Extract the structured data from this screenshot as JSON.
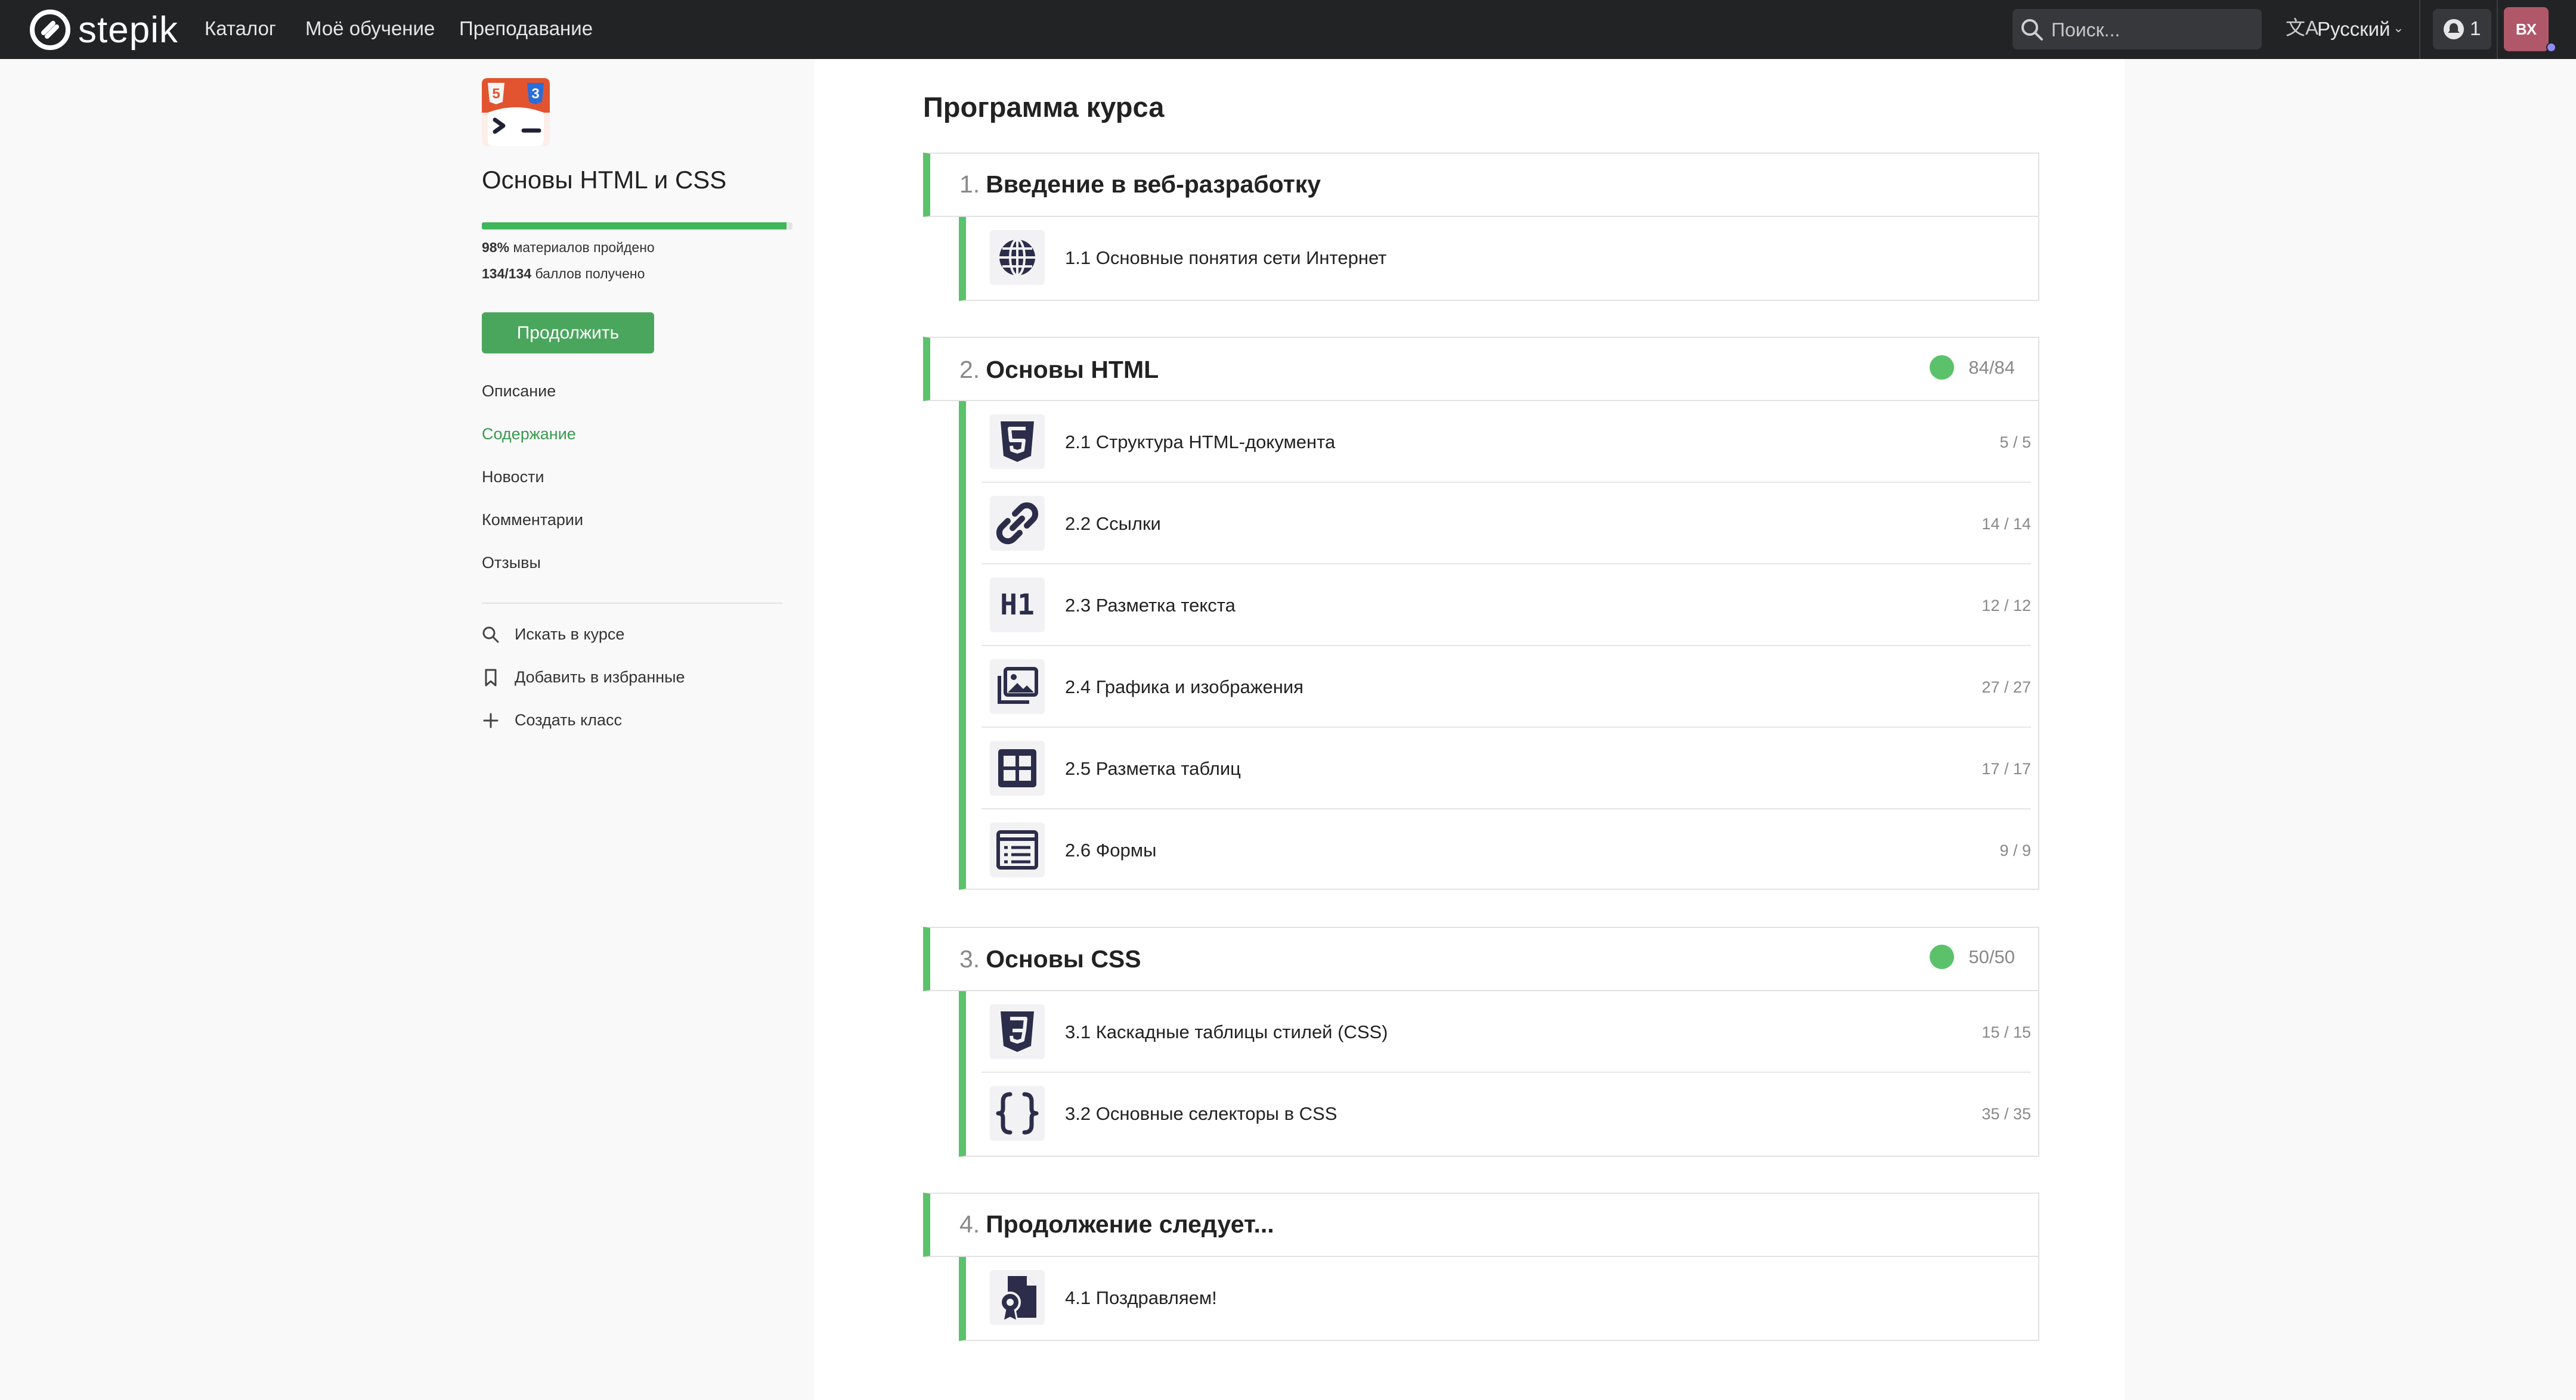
{
  "navbar": {
    "logo_text": "stepik",
    "links": [
      "Каталог",
      "Моё обучение",
      "Преподавание"
    ],
    "search_placeholder": "Поиск...",
    "language": "Русский",
    "notifications_count": "1",
    "avatar_initials": "ВХ"
  },
  "sidebar": {
    "course_title": "Основы HTML и CSS",
    "progress_fraction": 0.98,
    "materials_value": "98%",
    "materials_label": "материалов пройдено",
    "points_value": "134/134",
    "points_label": "баллов получено",
    "continue_label": "Продолжить",
    "nav": [
      {
        "label": "Описание",
        "active": false
      },
      {
        "label": "Содержание",
        "active": true
      },
      {
        "label": "Новости",
        "active": false
      },
      {
        "label": "Комментарии",
        "active": false
      },
      {
        "label": "Отзывы",
        "active": false
      }
    ],
    "actions": [
      {
        "label": "Искать в курсе",
        "icon": "search-icon"
      },
      {
        "label": "Добавить в избранные",
        "icon": "bookmark-icon"
      },
      {
        "label": "Создать класс",
        "icon": "plus-icon"
      }
    ]
  },
  "program": {
    "title": "Программа курса",
    "modules": [
      {
        "number": "1.",
        "title": "Введение в веб-разработку",
        "score": "",
        "lessons": [
          {
            "title": "1.1 Основные понятия сети Интернет",
            "score": "",
            "icon": "globe-icon"
          }
        ]
      },
      {
        "number": "2.",
        "title": "Основы HTML",
        "score": "84/84",
        "lessons": [
          {
            "title": "2.1 Структура HTML-документа",
            "score": "5 / 5",
            "icon": "html5-icon"
          },
          {
            "title": "2.2 Ссылки",
            "score": "14 / 14",
            "icon": "link-icon"
          },
          {
            "title": "2.3 Разметка текста",
            "score": "12 / 12",
            "icon": "heading-h1-icon"
          },
          {
            "title": "2.4 Графика и изображения",
            "score": "27 / 27",
            "icon": "images-icon"
          },
          {
            "title": "2.5 Разметка таблиц",
            "score": "17 / 17",
            "icon": "table-icon"
          },
          {
            "title": "2.6 Формы",
            "score": "9 / 9",
            "icon": "form-icon"
          }
        ]
      },
      {
        "number": "3.",
        "title": "Основы CSS",
        "score": "50/50",
        "lessons": [
          {
            "title": "3.1 Каскадные таблицы стилей (CSS)",
            "score": "15 / 15",
            "icon": "css3-icon"
          },
          {
            "title": "3.2 Основные селекторы в CSS",
            "score": "35 / 35",
            "icon": "curly-braces-icon"
          }
        ]
      },
      {
        "number": "4.",
        "title": "Продолжение следует...",
        "score": "",
        "lessons": [
          {
            "title": "4.1 Поздравляем!",
            "score": "",
            "icon": "certificate-icon"
          }
        ]
      }
    ]
  },
  "colors": {
    "accent_green": "#5bc26b",
    "button_green": "#4aa65d",
    "navbar_bg": "#222325",
    "avatar_bg": "#b05869",
    "icon_navy": "#2b2d4a"
  }
}
